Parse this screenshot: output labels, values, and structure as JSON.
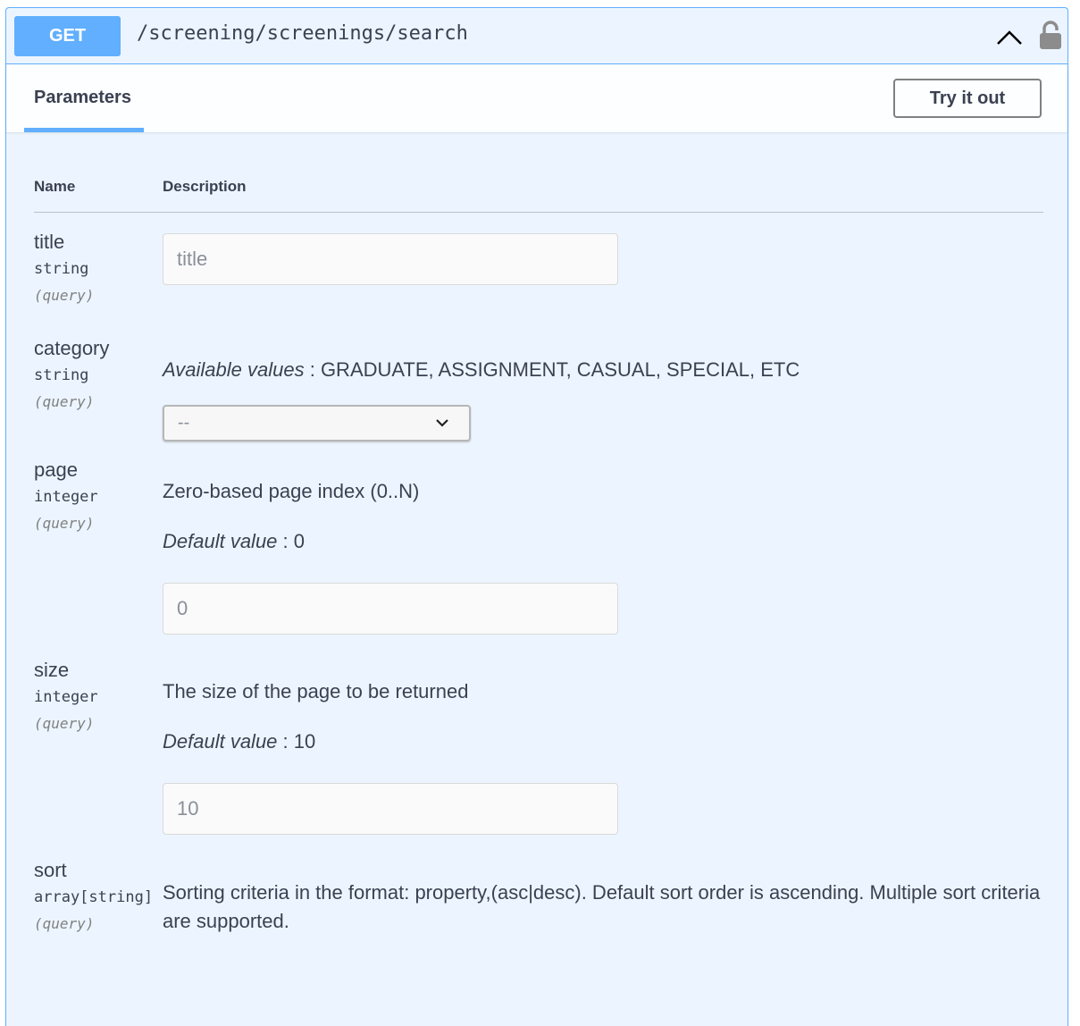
{
  "operation": {
    "method": "GET",
    "path": "/screening/screenings/search"
  },
  "tabs": {
    "parameters_label": "Parameters",
    "try_label": "Try it out"
  },
  "table": {
    "name_header": "Name",
    "description_header": "Description"
  },
  "parameters": [
    {
      "name": "title",
      "type": "string",
      "in": "(query)",
      "placeholder": "title"
    },
    {
      "name": "category",
      "type": "string",
      "in": "(query)",
      "available_label": "Available values",
      "available_values": "GRADUATE, ASSIGNMENT, CASUAL, SPECIAL, ETC",
      "selected": "--"
    },
    {
      "name": "page",
      "type": "integer",
      "in": "(query)",
      "description": "Zero-based page index (0..N)",
      "default_label": "Default value",
      "default_value": "0",
      "placeholder": "0"
    },
    {
      "name": "size",
      "type": "integer",
      "in": "(query)",
      "description": "The size of the page to be returned",
      "default_label": "Default value",
      "default_value": "10",
      "placeholder": "10"
    },
    {
      "name": "sort",
      "type": "array[string]",
      "in": "(query)",
      "description": "Sorting criteria in the format: property,(asc|desc). Default sort order is ascending. Multiple sort criteria are supported."
    }
  ],
  "icons": {
    "collapse": "chevron-up-icon",
    "auth": "lock-icon"
  },
  "colors": {
    "accent": "#61affe",
    "text": "#3b4151"
  }
}
